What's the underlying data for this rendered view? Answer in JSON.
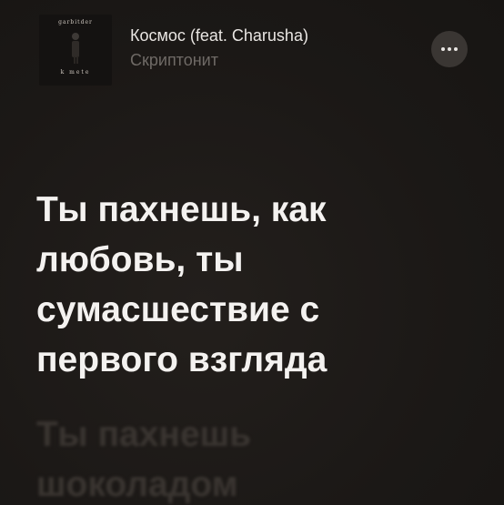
{
  "now_playing": {
    "cover_top_text": "garbitder",
    "cover_bottom_text": "k mete",
    "title": "Космос (feat. Charusha)",
    "artist": "Скриптонит"
  },
  "more_button": {
    "icon": "ellipsis-icon"
  },
  "lyrics": {
    "active": "Ты пахнешь, как\nлюбовь, ты\nсумасшествие с\nпервого взгляда",
    "next": "Ты пахнешь\nшоколадом"
  },
  "colors": {
    "background": "#1d1a18",
    "title": "#e9e6e3",
    "artist": "#6f6a66",
    "active_lyric": "#f4f2f0",
    "inactive_lyric": "#3a3531",
    "button_bg": "#3a3633"
  }
}
